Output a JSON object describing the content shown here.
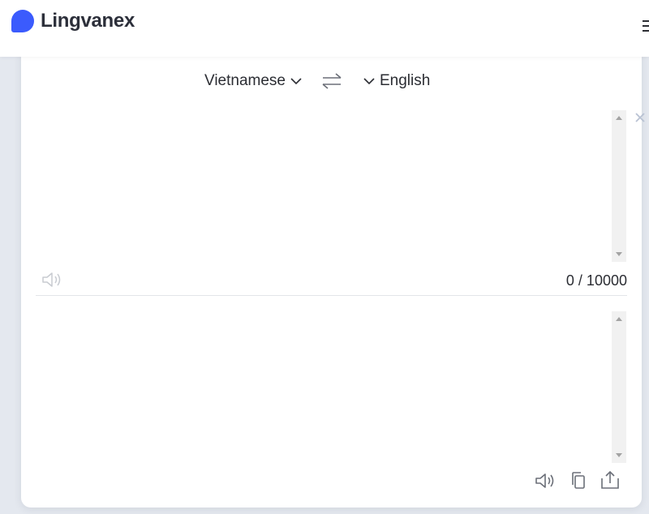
{
  "header": {
    "brand": "Lingvanex",
    "brand_color": "#3b5bfd",
    "menu_icon": "hamburger-menu-icon"
  },
  "translator": {
    "source_language": "Vietnamese",
    "target_language": "English",
    "swap_icon": "swap-arrows-icon",
    "source_text": "",
    "char_count": "0 / 10000",
    "target_text": "",
    "clear_icon": "close-icon",
    "source_speak_icon": "speaker-icon",
    "target_tools": [
      "speaker-icon",
      "copy-icon",
      "share-icon"
    ]
  }
}
